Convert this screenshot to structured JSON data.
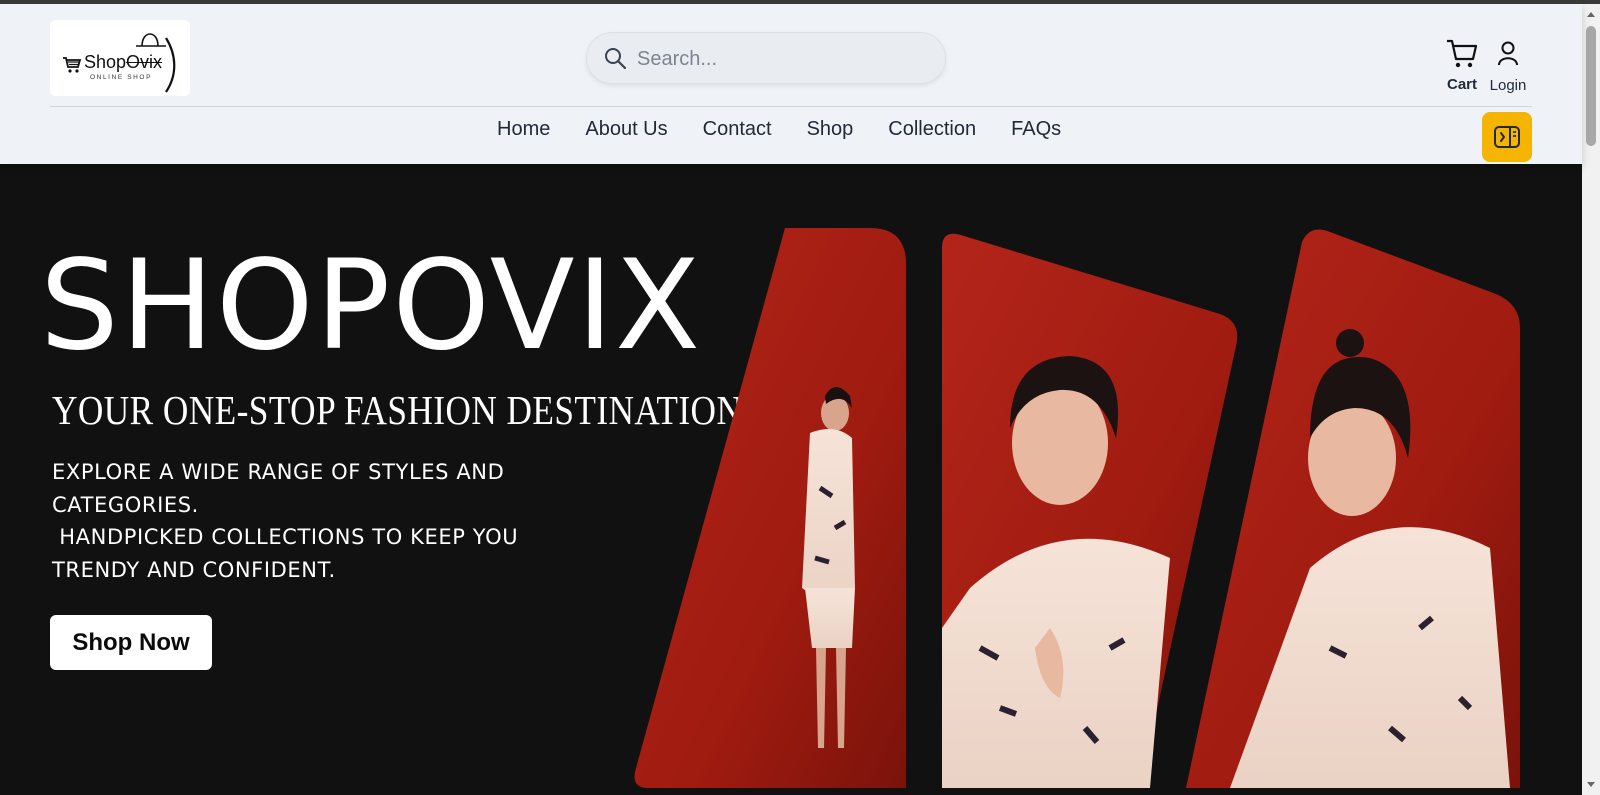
{
  "header": {
    "logo": {
      "brand_prefix": "Shop",
      "brand_suffix": "Ovix",
      "tagline": "ONLINE SHOP"
    },
    "search": {
      "placeholder": "Search..."
    },
    "cart_label": "Cart",
    "login_label": "Login",
    "accent_color": "#f4b400"
  },
  "nav": {
    "items": [
      "Home",
      "About Us",
      "Contact",
      "Shop",
      "Collection",
      "FAQs"
    ]
  },
  "hero": {
    "title": "SHOPOVIX",
    "subtitle": "YOUR ONE-STOP FASHION DESTINATION",
    "description_line1": "EXPLORE A WIDE RANGE OF STYLES AND CATEGORIES.",
    "description_line2": " HANDPICKED COLLECTIONS TO KEEP YOU TRENDY AND CONFIDENT.",
    "cta_label": "Shop Now",
    "background_color": "#111111",
    "photo_bg_color": "#b01e12"
  }
}
